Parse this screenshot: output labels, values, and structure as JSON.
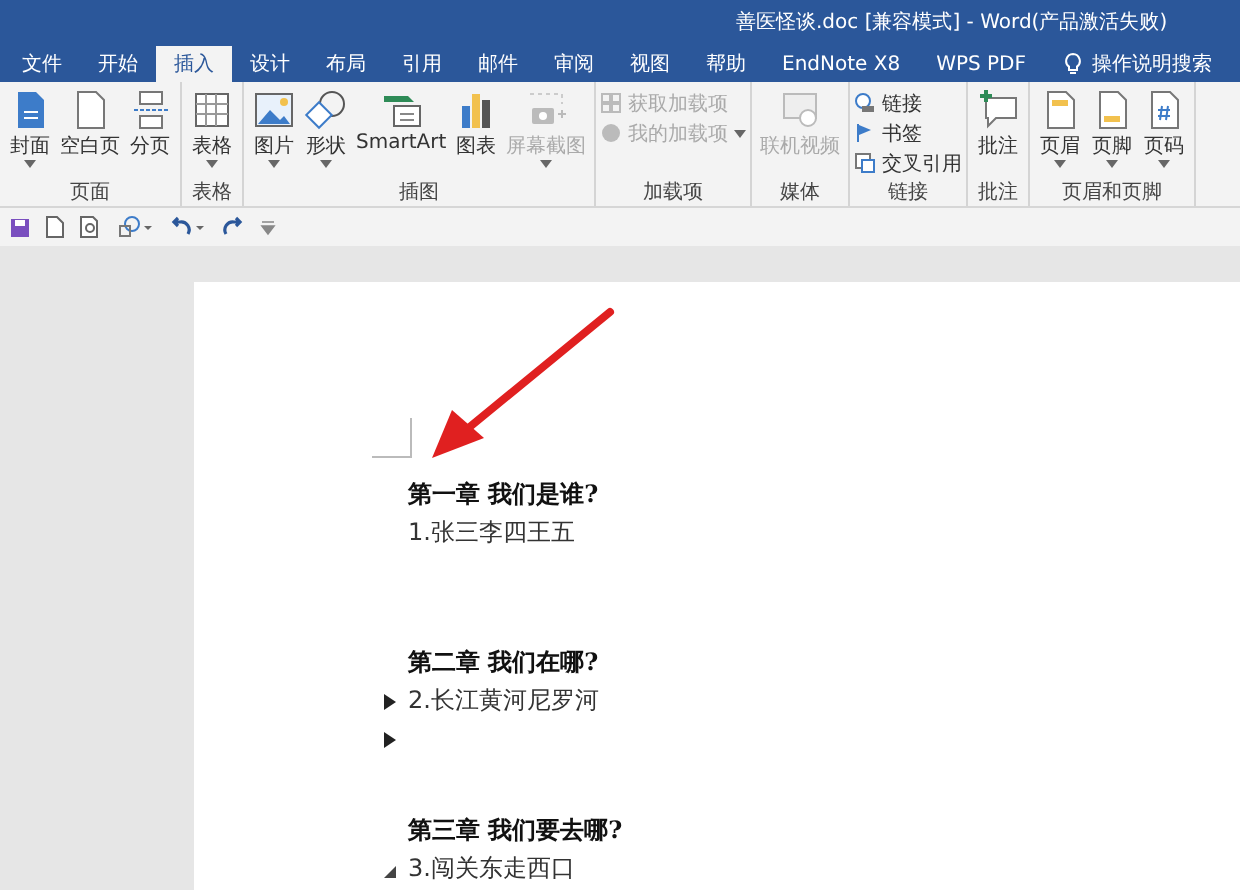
{
  "window": {
    "title": "善医怪谈.doc [兼容模式]  -  Word(产品激活失败)"
  },
  "tabs": [
    {
      "label": "文件",
      "selected": false
    },
    {
      "label": "开始",
      "selected": false
    },
    {
      "label": "插入",
      "selected": true
    },
    {
      "label": "设计",
      "selected": false
    },
    {
      "label": "布局",
      "selected": false
    },
    {
      "label": "引用",
      "selected": false
    },
    {
      "label": "邮件",
      "selected": false
    },
    {
      "label": "审阅",
      "selected": false
    },
    {
      "label": "视图",
      "selected": false
    },
    {
      "label": "帮助",
      "selected": false
    },
    {
      "label": "EndNote X8",
      "selected": false
    },
    {
      "label": "WPS PDF",
      "selected": false
    }
  ],
  "search": {
    "placeholder": "操作说明搜索"
  },
  "ribbon": [
    {
      "label": "页面",
      "items": [
        {
          "label": "封面",
          "kind": "big",
          "disabled": false,
          "dropdown": true
        },
        {
          "label": "空白页",
          "kind": "big",
          "disabled": false,
          "dropdown": false
        },
        {
          "label": "分页",
          "kind": "big",
          "disabled": false,
          "dropdown": false
        }
      ]
    },
    {
      "label": "表格",
      "items": [
        {
          "label": "表格",
          "kind": "big",
          "disabled": false,
          "dropdown": true
        }
      ]
    },
    {
      "label": "插图",
      "items": [
        {
          "label": "图片",
          "kind": "big",
          "disabled": false,
          "dropdown": true
        },
        {
          "label": "形状",
          "kind": "big",
          "disabled": false,
          "dropdown": true
        },
        {
          "label": "SmartArt",
          "kind": "big",
          "disabled": false,
          "dropdown": false
        },
        {
          "label": "图表",
          "kind": "big",
          "disabled": false,
          "dropdown": false
        },
        {
          "label": "屏幕截图",
          "kind": "big",
          "disabled": true,
          "dropdown": true
        }
      ]
    },
    {
      "label": "加载项",
      "items": [
        {
          "label": "获取加载项",
          "kind": "small",
          "disabled": true,
          "dropdown": false
        },
        {
          "label": "我的加载项",
          "kind": "small",
          "disabled": true,
          "dropdown": true
        }
      ]
    },
    {
      "label": "媒体",
      "items": [
        {
          "label": "联机视频",
          "kind": "big",
          "disabled": true,
          "dropdown": false
        }
      ]
    },
    {
      "label": "链接",
      "items": [
        {
          "label": "链接",
          "kind": "small",
          "disabled": false,
          "dropdown": false
        },
        {
          "label": "书签",
          "kind": "small",
          "disabled": false,
          "dropdown": false
        },
        {
          "label": "交叉引用",
          "kind": "small",
          "disabled": false,
          "dropdown": false
        }
      ]
    },
    {
      "label": "批注",
      "items": [
        {
          "label": "批注",
          "kind": "big",
          "disabled": false,
          "dropdown": false
        }
      ]
    },
    {
      "label": "页眉和页脚",
      "items": [
        {
          "label": "页眉",
          "kind": "big",
          "disabled": false,
          "dropdown": true
        },
        {
          "label": "页脚",
          "kind": "big",
          "disabled": false,
          "dropdown": true
        },
        {
          "label": "页码",
          "kind": "big",
          "disabled": false,
          "dropdown": true
        }
      ]
    }
  ],
  "document": [
    {
      "kind": "heading",
      "text": "第一章  我们是谁?"
    },
    {
      "kind": "body",
      "text": "1.张三李四王五"
    },
    {
      "kind": "blank"
    },
    {
      "kind": "blank"
    },
    {
      "kind": "heading",
      "text": "第二章  我们在哪?"
    },
    {
      "kind": "body",
      "text": "2.长江黄河尼罗河",
      "expanded": false
    },
    {
      "kind": "blank",
      "expanded": false
    },
    {
      "kind": "blank"
    },
    {
      "kind": "heading",
      "text": "第三章  我们要去哪?"
    },
    {
      "kind": "body",
      "text": "3.闯关东走西口",
      "expanded": true
    }
  ]
}
